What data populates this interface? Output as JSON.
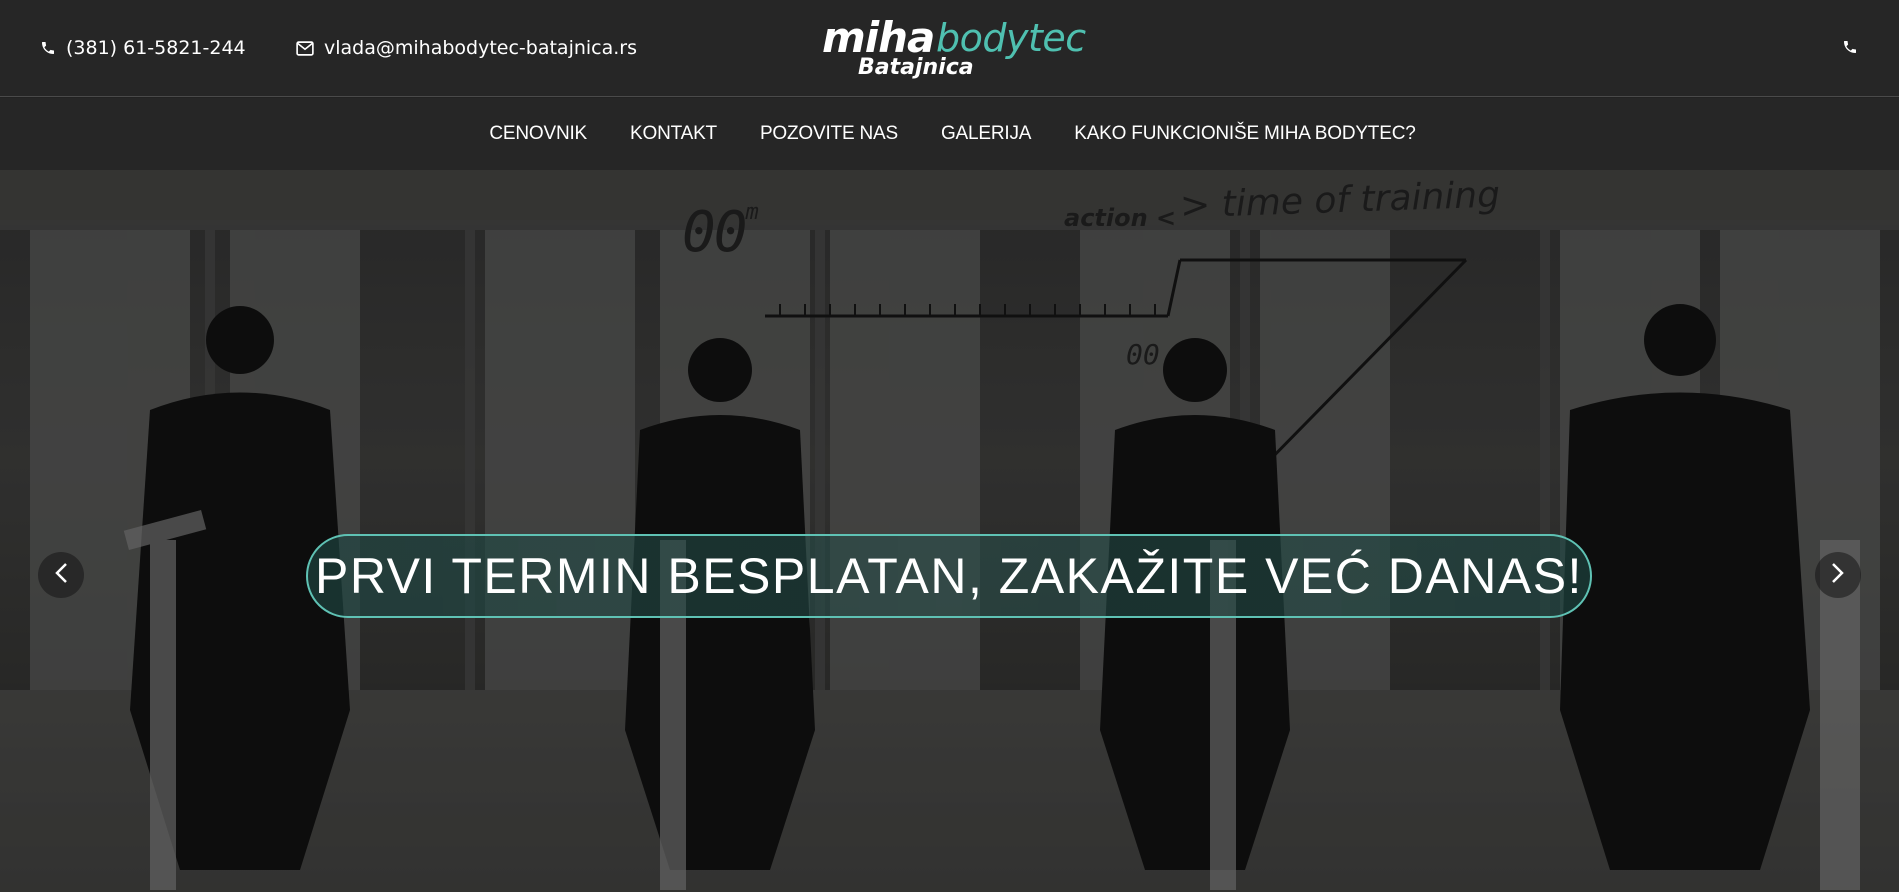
{
  "header": {
    "phone": "(381) 61-5821-244",
    "email": "vlada@mihabodytec-batajnica.rs",
    "logo": {
      "word1": "miha",
      "word2": "bodytec",
      "location": "Batajnica"
    },
    "accent_color": "#4fc0b0",
    "icons": {
      "phone": "phone-icon",
      "email": "envelope-icon",
      "phone_right": "phone-icon"
    }
  },
  "nav": {
    "items": [
      {
        "label": "CENOVNIK"
      },
      {
        "label": "KONTAKT"
      },
      {
        "label": "POZOVITE NAS"
      },
      {
        "label": "GALERIJA"
      },
      {
        "label": "KAKO FUNKCIONIŠE MIHA BODYTEC?"
      }
    ]
  },
  "hero": {
    "banner_text": "PRVI TERMIN BESPLATAN, ZAKAŽITE VEĆ DANAS!",
    "overlay": {
      "timer": "00",
      "timer_unit": "m",
      "action": "action <",
      "time_of_training": "> time of training",
      "small_timer": "00"
    },
    "controls": {
      "prev": "chevron-left-icon",
      "next": "chevron-right-icon"
    }
  }
}
